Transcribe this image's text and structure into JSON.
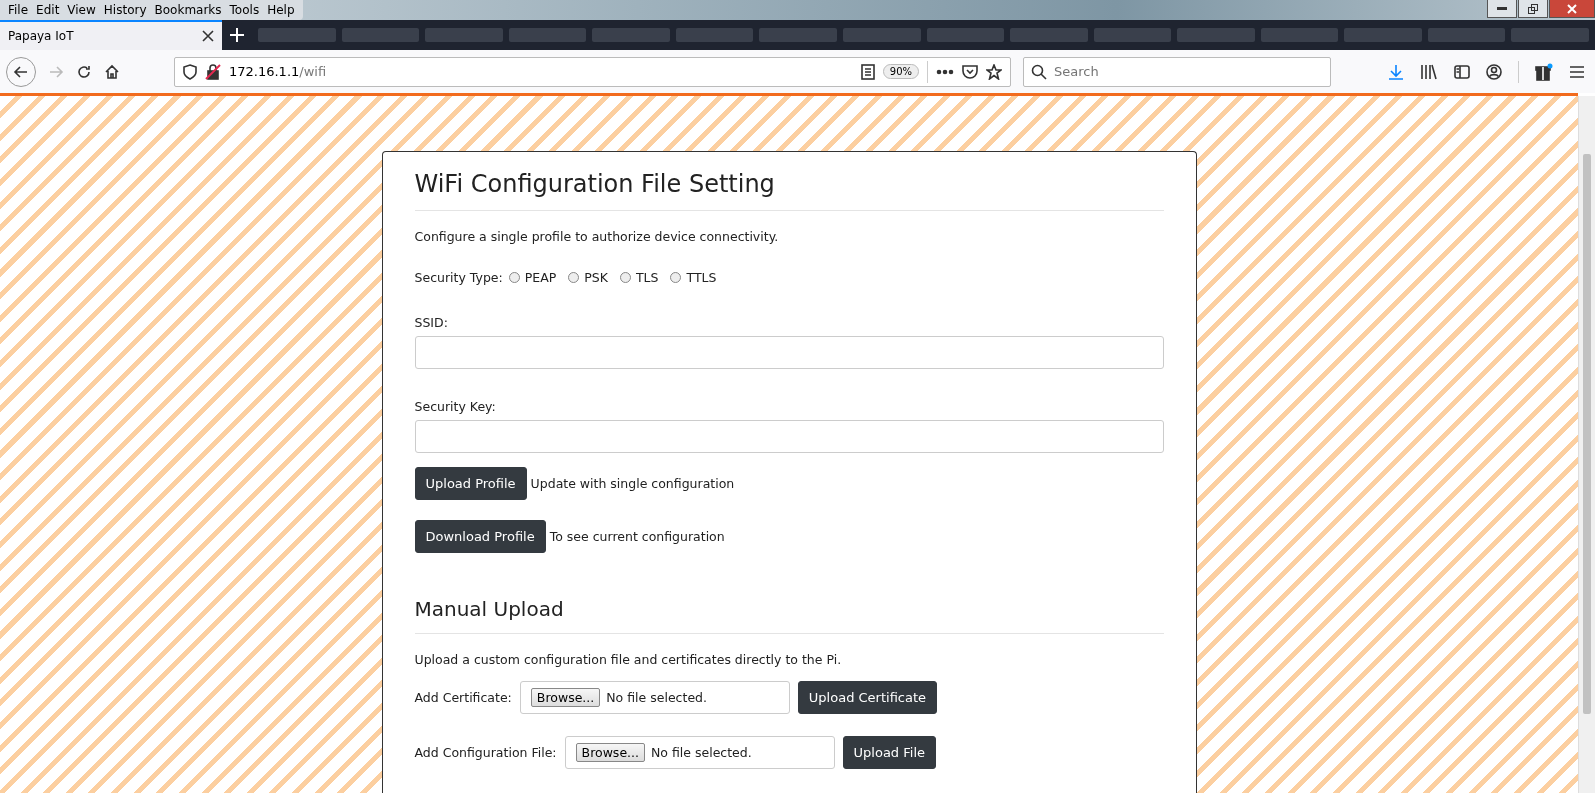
{
  "menu": [
    "File",
    "Edit",
    "View",
    "History",
    "Bookmarks",
    "Tools",
    "Help"
  ],
  "tabs": [
    {
      "label": "Papaya IoT",
      "selected": true
    }
  ],
  "forward_button": {
    "disabled": true
  },
  "address_bar": {
    "host": "172.16.1.1",
    "path": "/wifi",
    "zoom": "90%"
  },
  "search": {
    "placeholder": "Search"
  },
  "page": {
    "title": "WiFi Configuration File Setting",
    "intro": "Configure a single profile to authorize device connectivity.",
    "security_type": {
      "label": "Security Type:",
      "options": [
        {
          "label": "PEAP",
          "selected": false
        },
        {
          "label": "PSK",
          "selected": false
        },
        {
          "label": "TLS",
          "selected": false
        },
        {
          "label": "TTLS",
          "selected": false
        }
      ]
    },
    "fields": [
      {
        "label": "SSID:"
      },
      {
        "label": "Security Key:"
      }
    ],
    "actions": [
      {
        "button": "Upload Profile",
        "note": "Update with single configuration"
      },
      {
        "button": "Download Profile",
        "note": "To see current configuration"
      }
    ],
    "manual": {
      "title": "Manual Upload",
      "intro": "Upload a custom configuration file and certificates directly to the Pi.",
      "uploads": [
        {
          "label": "Add Certificate:",
          "browse": "Browse...",
          "file_status": "No file selected.",
          "button": "Upload Certificate"
        },
        {
          "label": "Add Configuration File:",
          "browse": "Browse...",
          "file_status": "No file selected.",
          "button": "Upload File"
        }
      ]
    }
  }
}
